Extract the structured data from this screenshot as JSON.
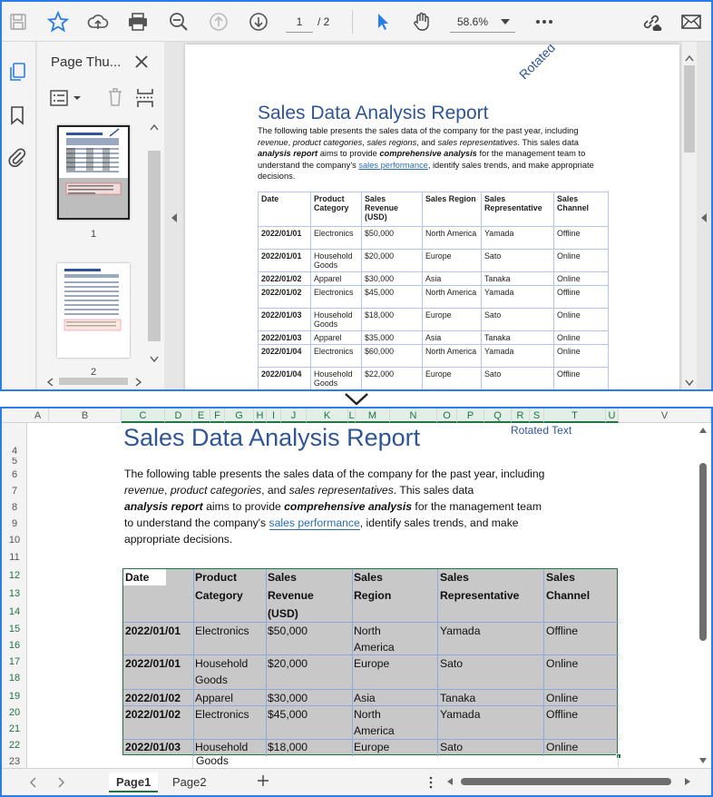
{
  "pdf_viewer": {
    "toolbar": {
      "page_current": "1",
      "page_total": "/ 2",
      "zoom": "58.6%"
    },
    "thumbnail_panel": {
      "title": "Page Thu...",
      "page_labels": [
        "1",
        "2"
      ]
    },
    "page": {
      "title": "Sales Data Analysis Report",
      "rotated_text": "Rotated Text",
      "paragraph": {
        "p1": "The following table presents the sales data of the company for the past year, including ",
        "revenue": "revenue",
        "c1": ", ",
        "product_categories": "product categories",
        "c2": ", ",
        "sales_regions": "sales regions",
        "c3": ", and ",
        "sales_representatives": "sales representatives",
        "c4": ". This sales data ",
        "analysis_report": "analysis report",
        "c5": " aims to provide ",
        "comprehensive_analysis": "comprehensive analysis",
        "c6": " for the management team to understand the company's ",
        "link": "sales performance",
        "c7": ", identify sales trends, and make appropriate decisions."
      },
      "table": {
        "headers": [
          "Date",
          "Product Category",
          "Sales Revenue (USD)",
          "Sales Region",
          "Sales Representative",
          "Sales Channel"
        ],
        "rows": [
          [
            "2022/01/01",
            "Electronics",
            "$50,000",
            "North America",
            "Yamada",
            "Offline"
          ],
          [
            "2022/01/01",
            "Household Goods",
            "$20,000",
            "Europe",
            "Sato",
            "Online"
          ],
          [
            "2022/01/02",
            "Apparel",
            "$30,000",
            "Asia",
            "Tanaka",
            "Online"
          ],
          [
            "2022/01/02",
            "Electronics",
            "$45,000",
            "North America",
            "Yamada",
            "Offline"
          ],
          [
            "2022/01/03",
            "Household Goods",
            "$18,000",
            "Europe",
            "Sato",
            "Online"
          ],
          [
            "2022/01/03",
            "Apparel",
            "$35,000",
            "Asia",
            "Tanaka",
            "Online"
          ],
          [
            "2022/01/04",
            "Electronics",
            "$60,000",
            "North America",
            "Yamada",
            "Online"
          ],
          [
            "2022/01/04",
            "Household Goods",
            "$22,000",
            "Europe",
            "Sato",
            "Offline"
          ]
        ]
      }
    }
  },
  "spreadsheet": {
    "columns": [
      "A",
      "B",
      "C",
      "D",
      "E",
      "F",
      "G",
      "H",
      "I",
      "J",
      "K",
      "L",
      "M",
      "N",
      "O",
      "P",
      "Q",
      "R",
      "S",
      "T",
      "U",
      "V"
    ],
    "rows": [
      "4",
      "5",
      "6",
      "7",
      "8",
      "9",
      "10",
      "11",
      "12",
      "13",
      "14",
      "15",
      "16",
      "17",
      "18",
      "19",
      "20",
      "21",
      "22",
      "23"
    ],
    "title": "Sales Data Analysis Report",
    "rotated_text": "Rotated Text",
    "para_lines": {
      "l1": "The following table presents the sales data of the company for the past year, including",
      "l2a": "revenue",
      "l2b": ", ",
      "l2c": "product categories",
      "l2d": ", and ",
      "l2e": "sales representatives",
      "l2f": ". This sales data",
      "l3a": "analysis report",
      "l3b": " aims to provide ",
      "l3c": "comprehensive analysis",
      "l3d": " for the management team",
      "l4a": "to understand the company's ",
      "l4b": "sales performance",
      "l4c": ", identify sales trends, and make",
      "l5": "appropriate decisions."
    },
    "table": {
      "h_date": "Date",
      "h_prod1": "Product",
      "h_prod2": "Category",
      "h_rev1": "Sales",
      "h_rev2": "Revenue",
      "h_rev3": "(USD)",
      "h_reg1": "Sales",
      "h_reg2": "Region",
      "h_rep1": "Sales",
      "h_rep2": "Representative",
      "h_ch1": "Sales",
      "h_ch2": "Channel",
      "r1": [
        "2022/01/01",
        "Electronics",
        "$50,000",
        "North",
        "America",
        "Yamada",
        "Offline"
      ],
      "r2": [
        "2022/01/01",
        "Household",
        "Goods",
        "$20,000",
        "Europe",
        "Sato",
        "Online"
      ],
      "r3": [
        "2022/01/02",
        "Apparel",
        "$30,000",
        "Asia",
        "Tanaka",
        "Online"
      ],
      "r4": [
        "2022/01/02",
        "Electronics",
        "$45,000",
        "North",
        "America",
        "Yamada",
        "Offline"
      ],
      "r5": [
        "2022/01/03",
        "Household",
        "$18,000",
        "Europe",
        "Sato",
        "Online"
      ],
      "r5_overflow": "Goods"
    },
    "tabs": [
      "Page1",
      "Page2"
    ]
  }
}
